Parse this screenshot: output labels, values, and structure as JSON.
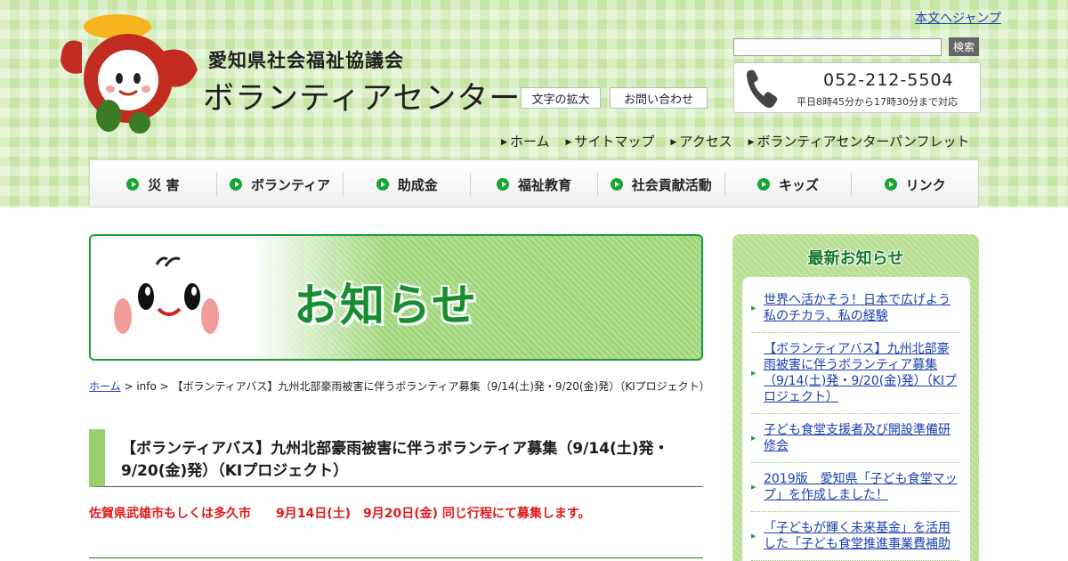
{
  "header": {
    "org_name": "愛知県社会福祉協議会",
    "site_name": "ボランティアセンター",
    "skip_link": "本文へジャンプ",
    "search": {
      "placeholder": "",
      "button": "検索"
    },
    "contact": {
      "tel": "052-212-5504",
      "hours": "平日8時45分から17時30分まで対応"
    },
    "util_buttons": [
      "文字の拡大",
      "お問い合わせ"
    ],
    "util_nav": [
      "ホーム",
      "サイトマップ",
      "アクセス",
      "ボランティアセンターパンフレット"
    ]
  },
  "global_nav": [
    "災 害",
    "ボランティア",
    "助成金",
    "福祉教育",
    "社会貢献活動",
    "キッズ",
    "リンク"
  ],
  "banner": {
    "title": "お知らせ"
  },
  "breadcrumb": {
    "home": "ホーム",
    "rest": " > info > 【ボランティアバス】九州北部豪雨被害に伴うボランティア募集（9/14(土)発・9/20(金)発）（KIプロジェクト）"
  },
  "post": {
    "title": "【ボランティアバス】九州北部豪雨被害に伴うボランティア募集（9/14(土)発・9/20(金)発）（KIプロジェクト）",
    "lead": "佐賀県武雄市もしくは多久市　　9月14日(土)　9月20日(金) 同じ行程にて募集します。"
  },
  "sidebar": {
    "title": "最新お知らせ",
    "items": [
      "世界へ活かそう！日本で広げよう私のチカラ、私の経験",
      "【ボランティアバス】九州北部豪雨被害に伴うボランティア募集（9/14(土)発・9/20(金)発）（KIプロジェクト）",
      "子ども食堂支援者及び開設準備研修会",
      "2019版　愛知県「子ども食堂マップ」を作成しました！",
      "「子どもが輝く未来基金」を活用した「子ども食堂推進事業費補助"
    ]
  },
  "colors": {
    "accent_green": "#17a536",
    "band_green": "#c6e6a6",
    "alert_red": "#e01b1b",
    "link_blue": "#1a3fb0"
  }
}
